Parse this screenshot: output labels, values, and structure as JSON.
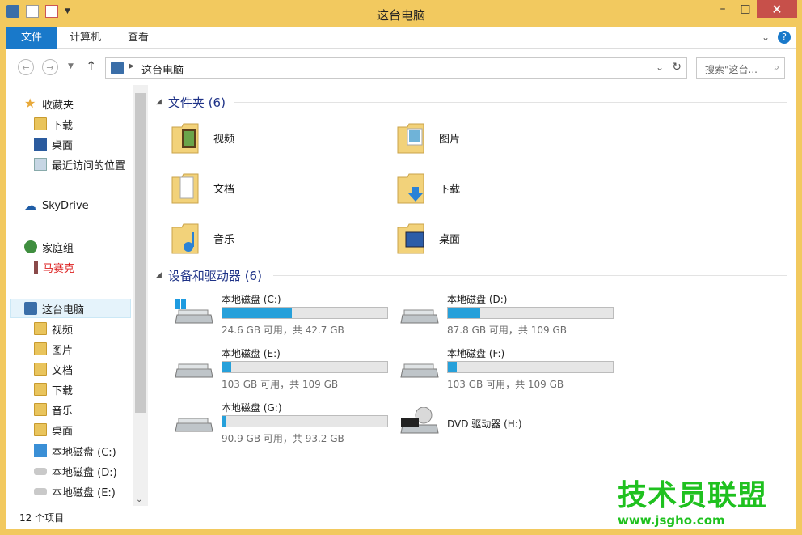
{
  "window": {
    "title": "这台电脑"
  },
  "ribbon": {
    "tabs": [
      "文件",
      "计算机",
      "查看"
    ]
  },
  "address": {
    "path": "这台电脑",
    "search_placeholder": "搜索\"这台..."
  },
  "nav": {
    "favorites": {
      "label": "收藏夹",
      "items": [
        "下载",
        "桌面",
        "最近访问的位置"
      ]
    },
    "skydrive": "SkyDrive",
    "homegroup": {
      "label": "家庭组",
      "items": [
        "马赛克"
      ]
    },
    "thispc": {
      "label": "这台电脑",
      "items": [
        "视频",
        "图片",
        "文档",
        "下载",
        "音乐",
        "桌面",
        "本地磁盘 (C:)",
        "本地磁盘 (D:)",
        "本地磁盘 (E:)"
      ]
    }
  },
  "groups": {
    "folders": {
      "label": "文件夹 (6)",
      "items": [
        {
          "name": "视频",
          "icon": "video-folder-icon"
        },
        {
          "name": "图片",
          "icon": "pictures-folder-icon"
        },
        {
          "name": "文档",
          "icon": "documents-folder-icon"
        },
        {
          "name": "下载",
          "icon": "downloads-folder-icon"
        },
        {
          "name": "音乐",
          "icon": "music-folder-icon"
        },
        {
          "name": "桌面",
          "icon": "desktop-folder-icon"
        }
      ]
    },
    "drives": {
      "label": "设备和驱动器 (6)",
      "items": [
        {
          "name": "本地磁盘 (C:)",
          "size": "24.6 GB 可用，共 42.7 GB",
          "used": 0.42
        },
        {
          "name": "本地磁盘 (D:)",
          "size": "87.8 GB 可用，共 109 GB",
          "used": 0.195
        },
        {
          "name": "本地磁盘 (E:)",
          "size": "103 GB 可用，共 109 GB",
          "used": 0.055
        },
        {
          "name": "本地磁盘 (F:)",
          "size": "103 GB 可用，共 109 GB",
          "used": 0.055
        },
        {
          "name": "本地磁盘 (G:)",
          "size": "90.9 GB 可用，共 93.2 GB",
          "used": 0.025
        },
        {
          "name": "DVD 驱动器 (H:)",
          "size": "",
          "used": null
        }
      ]
    }
  },
  "status": {
    "count": "12 个项目"
  },
  "watermark": {
    "brand": "技术员联盟",
    "site": "www.jsgho.com"
  },
  "colors": {
    "accent": "#1979ca",
    "bar": "#26a0da",
    "frame": "#f2c95f",
    "group_header": "#1e3287"
  }
}
